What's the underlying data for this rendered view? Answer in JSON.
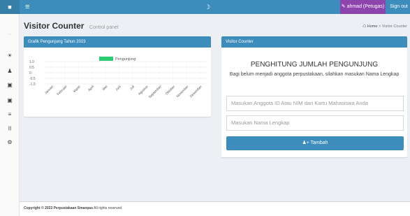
{
  "topbar": {
    "user_label": "ahmad (Petugas)",
    "signout_label": "Sign out"
  },
  "header": {
    "title": "Visitor Counter",
    "subtitle": "Control panel",
    "breadcrumb_home": "Home",
    "breadcrumb_sep": ">",
    "breadcrumb_current": "Visitor Counter"
  },
  "chart_panel": {
    "heading": "Grafik Pengunjung Tahun 2023"
  },
  "chart_data": {
    "type": "bar",
    "categories": [
      "Januari",
      "Februari",
      "Maret",
      "April",
      "Mei",
      "Juni",
      "Juli",
      "Agustus",
      "September",
      "Oktober",
      "November",
      "Desember"
    ],
    "series": [
      {
        "name": "Pengunjung",
        "values": [
          0,
          0,
          0,
          0,
          0,
          0,
          0,
          0,
          0,
          0,
          0,
          0
        ]
      }
    ],
    "yticks": [
      "1.0",
      "0.5",
      "0",
      "-0.5",
      "-1.0"
    ],
    "ylim": [
      -1.0,
      1.0
    ],
    "legend_color": "#2ecc71",
    "grid": true,
    "legend": "top"
  },
  "visitor_panel": {
    "heading": "Visitor Counter",
    "title": "PENGHITUNG JUMLAH PENGUNJUNG",
    "description": "Bagi belum menjadi anggota perpustakaan, silahkan masukan Nama Lengkap",
    "id_placeholder": "Masukan Anggota ID Atau NIM dari Kartu Mahasiswa Anda",
    "name_placeholder": "Masukan Nama Lengkap",
    "add_label": "Tambah"
  },
  "footer": {
    "copyright": "Copyright © 2023 Perpustakaan Smanpas",
    "rights": "All rights reserved"
  },
  "colors": {
    "primary": "#3c8dbc",
    "user_button": "#8e44ad",
    "legend_green": "#2ecc71"
  },
  "icons": {
    "sidebar": [
      "dashboard-icon",
      "users-icon",
      "book-icon",
      "edit-icon",
      "list-icon",
      "barcode-icon",
      "settings-icon"
    ],
    "topbar": [
      "logo-icon",
      "menu-icon",
      "moon-icon",
      "edit-icon"
    ],
    "breadcrumb": "home-icon",
    "add_button": "user-plus-icon"
  }
}
